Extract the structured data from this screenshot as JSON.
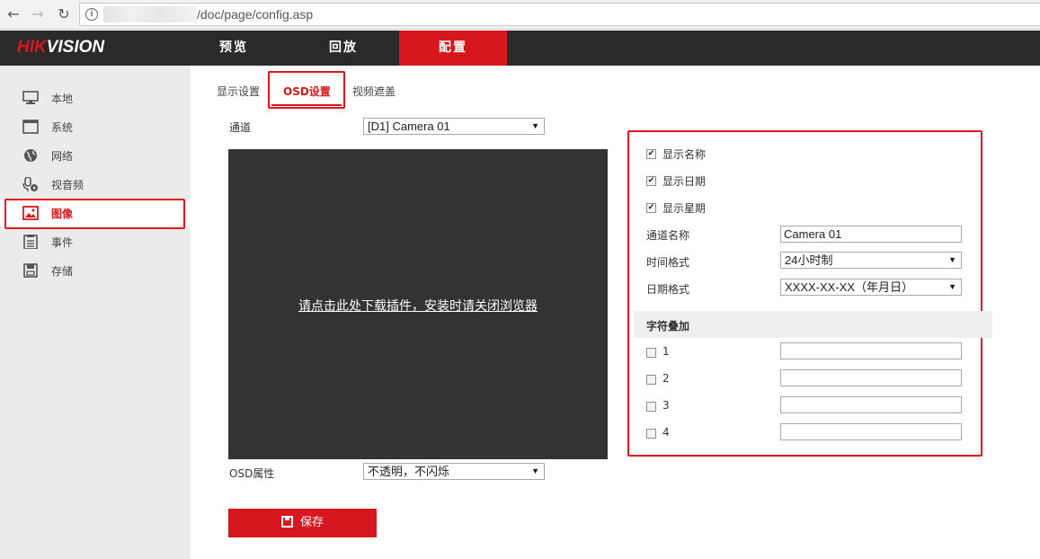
{
  "browser": {
    "back_icon": "arrow-left-icon",
    "forward_icon": "arrow-right-icon",
    "reload_icon": "reload-icon",
    "url": "/doc/page/config.asp"
  },
  "header": {
    "logo_red": "HIK",
    "logo_white": "VISION",
    "tabs": [
      {
        "label": "预览"
      },
      {
        "label": "回放"
      },
      {
        "label": "配置"
      }
    ],
    "accent": "#d6171d"
  },
  "sidebar": {
    "items": [
      {
        "label": "本地",
        "icon": "monitor-icon"
      },
      {
        "label": "系统",
        "icon": "system-window-icon"
      },
      {
        "label": "网络",
        "icon": "globe-icon"
      },
      {
        "label": "视音频",
        "icon": "microphone-icon"
      },
      {
        "label": "图像",
        "icon": "image-icon"
      },
      {
        "label": "事件",
        "icon": "event-list-icon"
      },
      {
        "label": "存储",
        "icon": "storage-disk-icon"
      }
    ]
  },
  "subtabs": [
    {
      "label": "显示设置"
    },
    {
      "label": "OSD设置"
    },
    {
      "label": "视频遮盖"
    }
  ],
  "form": {
    "channel_label": "通道",
    "channel_value": "[D1] Camera 01",
    "osd_attr_label": "OSD属性",
    "osd_attr_value": "不透明，不闪烁"
  },
  "video": {
    "plugin_text": "请点击此处下载插件，安装时请关闭浏览器"
  },
  "osd": {
    "show_name": {
      "label": "显示名称",
      "checked": true
    },
    "show_date": {
      "label": "显示日期",
      "checked": true
    },
    "show_week": {
      "label": "显示星期",
      "checked": true
    },
    "channel_name_label": "通道名称",
    "channel_name_value": "Camera 01",
    "time_format_label": "时间格式",
    "time_format_value": "24小时制",
    "date_format_label": "日期格式",
    "date_format_value": "XXXX-XX-XX（年月日）",
    "overlay_title": "字符叠加",
    "overlays": [
      {
        "label": "1",
        "value": ""
      },
      {
        "label": "2",
        "value": ""
      },
      {
        "label": "3",
        "value": ""
      },
      {
        "label": "4",
        "value": ""
      }
    ]
  },
  "save_label": "保存"
}
